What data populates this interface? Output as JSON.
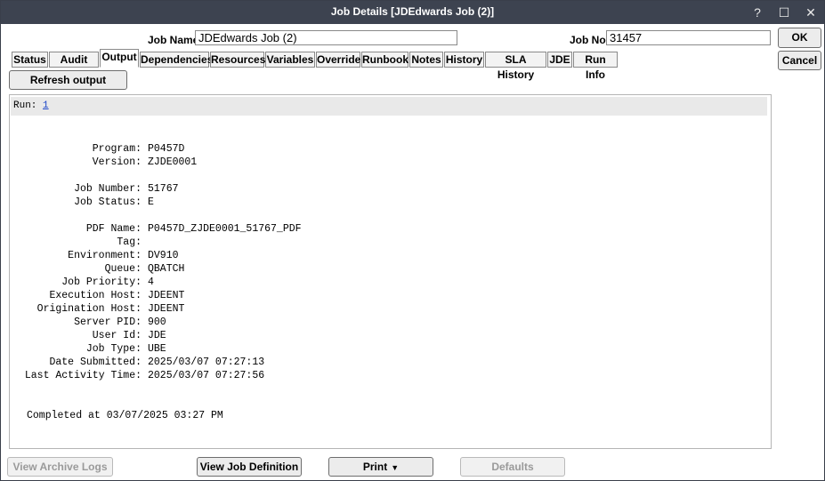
{
  "window": {
    "title": "Job Details [JDEdwards Job (2)]",
    "help_glyph": "?",
    "maximize_glyph": "☐",
    "close_glyph": "✕"
  },
  "header": {
    "job_name_label": "Job Name",
    "job_name_value": "JDEdwards Job (2)",
    "job_no_label": "Job No.",
    "job_no_value": "31457"
  },
  "buttons": {
    "ok": "OK",
    "cancel": "Cancel",
    "refresh_output": "Refresh output"
  },
  "tabs": [
    "Status",
    "Audit Log",
    "Output",
    "Dependencies",
    "Resources",
    "Variables",
    "Override",
    "Runbook",
    "Notes",
    "History",
    "SLA History",
    "JDE",
    "Run Info"
  ],
  "active_tab": "Output",
  "output": {
    "run_label": "Run:",
    "run_link": "1",
    "fields": [
      {
        "label": "Program:",
        "value": "P0457D"
      },
      {
        "label": "Version:",
        "value": "ZJDE0001"
      },
      {
        "label": "Job Number:",
        "value": "51767"
      },
      {
        "label": "Job Status:",
        "value": "E"
      },
      {
        "label": "PDF Name:",
        "value": "P0457D_ZJDE0001_51767_PDF"
      },
      {
        "label": "Tag:",
        "value": ""
      },
      {
        "label": "Environment:",
        "value": "DV910"
      },
      {
        "label": "Queue:",
        "value": "QBATCH"
      },
      {
        "label": "Job Priority:",
        "value": "4"
      },
      {
        "label": "Execution Host:",
        "value": "JDEENT"
      },
      {
        "label": "Origination Host:",
        "value": "JDEENT"
      },
      {
        "label": "Server PID:",
        "value": "900"
      },
      {
        "label": "User Id:",
        "value": "JDE"
      },
      {
        "label": "Job Type:",
        "value": "UBE"
      },
      {
        "label": "Date Submitted:",
        "value": "2025/03/07 07:27:13"
      },
      {
        "label": "Last Activity Time:",
        "value": "2025/03/07 07:27:56"
      }
    ],
    "completed": "Completed at 03/07/2025 03:27 PM"
  },
  "footer": {
    "view_archive_logs": "View Archive Logs",
    "view_job_definition": "View Job Definition",
    "print": "Print",
    "defaults": "Defaults"
  }
}
